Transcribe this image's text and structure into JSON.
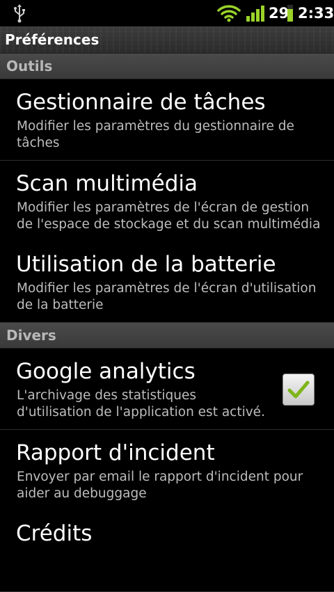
{
  "status_bar": {
    "battery_level": "29",
    "time": "2:33",
    "icons": [
      "usb-icon",
      "wifi-icon",
      "signal-icon",
      "battery-icon"
    ]
  },
  "title": "Préférences",
  "sections": {
    "outils": {
      "label": "Outils",
      "items": [
        {
          "title": "Gestionnaire de tâches",
          "summary": "Modifier les paramètres du gestionnaire de tâches"
        },
        {
          "title": "Scan multimédia",
          "summary": "Modifier les paramètres de l'écran de gestion de l'espace de stockage et du scan multimédia"
        },
        {
          "title": "Utilisation de la batterie",
          "summary": "Modifier les paramètres de l'écran d'utilisation de la batterie"
        }
      ]
    },
    "divers": {
      "label": "Divers",
      "items": [
        {
          "title": "Google analytics",
          "summary": "L'archivage des statistiques d'utilisation de l'application est activé.",
          "checked": true
        },
        {
          "title": "Rapport d'incident",
          "summary": "Envoyer par email le rapport d'incident pour aider au debuggage"
        },
        {
          "title": "Crédits",
          "summary": ""
        }
      ]
    }
  },
  "colors": {
    "accent_green": "#9bd22a",
    "checkmark_green": "#7fb51c",
    "section_text": "#b8b8b8",
    "summary_text": "#bdbdbd"
  }
}
